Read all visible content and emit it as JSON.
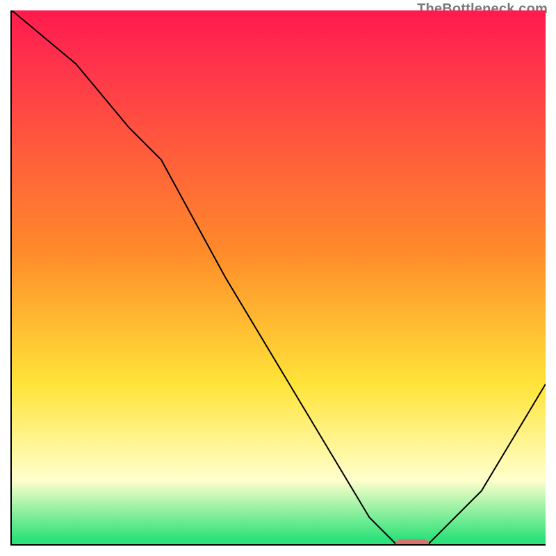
{
  "attribution": "TheBottleneck.com",
  "colors": {
    "top": "#ff1a4d",
    "red": "#ff2e4d",
    "orange": "#ff8a2a",
    "yellow": "#ffe438",
    "paleyellow": "#ffffcc",
    "green": "#2ee27a",
    "curve": "#000000",
    "marker": "#d8736f"
  },
  "chart_data": {
    "type": "line",
    "title": "",
    "xlabel": "",
    "ylabel": "",
    "xlim": [
      0,
      100
    ],
    "ylim": [
      0,
      100
    ],
    "series": [
      {
        "name": "bottleneck-curve",
        "x": [
          0,
          12,
          22,
          28,
          40,
          55,
          67,
          72,
          78,
          88,
          100
        ],
        "values": [
          100,
          90,
          78,
          72,
          50,
          25,
          5,
          0,
          0,
          10,
          30
        ]
      }
    ],
    "optimum_marker": {
      "x": 75,
      "y": 0
    },
    "background_gradient": {
      "dir": "top-to-bottom",
      "stops": [
        {
          "pos": 0.0,
          "colorKey": "top"
        },
        {
          "pos": 0.08,
          "colorKey": "red"
        },
        {
          "pos": 0.45,
          "colorKey": "orange"
        },
        {
          "pos": 0.7,
          "colorKey": "yellow"
        },
        {
          "pos": 0.88,
          "colorKey": "paleyellow"
        },
        {
          "pos": 0.99,
          "colorKey": "green"
        },
        {
          "pos": 1.0,
          "colorKey": "green"
        }
      ]
    }
  }
}
